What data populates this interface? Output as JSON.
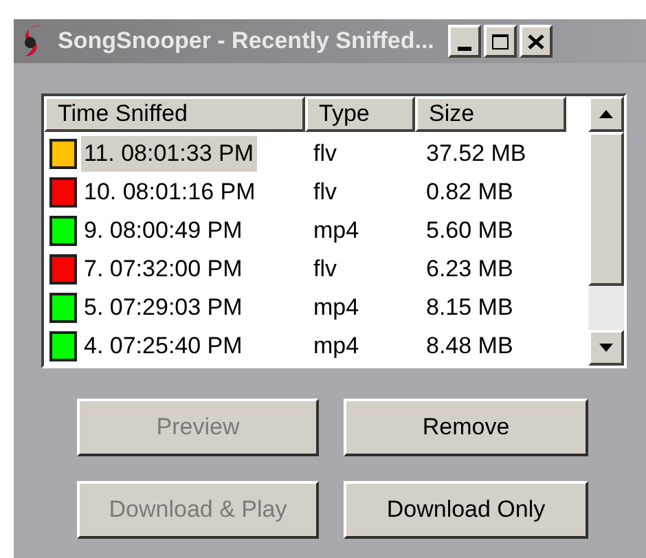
{
  "window": {
    "title": "SongSnooper - Recently Sniffed..."
  },
  "table": {
    "columns": [
      "Time Sniffed",
      "Type",
      "Size"
    ],
    "rows": [
      {
        "time": "11. 08:01:33 PM",
        "type": "flv",
        "size": "37.52 MB",
        "color": "#ffc000",
        "selected": true
      },
      {
        "time": "10. 08:01:16 PM",
        "type": "flv",
        "size": "0.82 MB",
        "color": "#ff0000",
        "selected": false
      },
      {
        "time": "9. 08:00:49 PM",
        "type": "mp4",
        "size": "5.60 MB",
        "color": "#00ff00",
        "selected": false
      },
      {
        "time": "7. 07:32:00 PM",
        "type": "flv",
        "size": "6.23 MB",
        "color": "#ff0000",
        "selected": false
      },
      {
        "time": "5. 07:29:03 PM",
        "type": "mp4",
        "size": "8.15 MB",
        "color": "#00ff00",
        "selected": false
      },
      {
        "time": "4. 07:25:40 PM",
        "type": "mp4",
        "size": "8.48 MB",
        "color": "#00ff00",
        "selected": false
      }
    ]
  },
  "buttons": [
    {
      "label": "Preview",
      "disabled": true
    },
    {
      "label": "Remove",
      "disabled": false
    },
    {
      "label": "Download & Play",
      "disabled": true
    },
    {
      "label": "Download Only",
      "disabled": false
    }
  ]
}
